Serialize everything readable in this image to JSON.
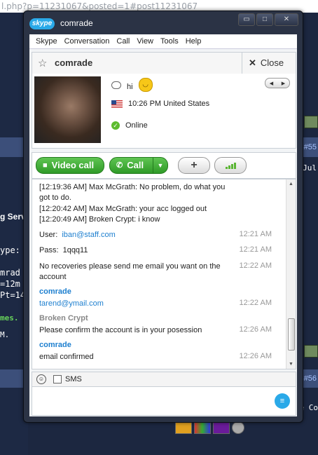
{
  "browser": {
    "url_fragment": "l.php?p=11231067&posted=1#post11231067"
  },
  "background_forum": {
    "post_num_1": "#55",
    "post_num_2": "#56",
    "fragment_jul": "Jul",
    "fragment_serv": "g Serv",
    "fragment_ype": "ype:",
    "fragment_mrad": "mrad",
    "fragment_12m": "=12m",
    "fragment_pt14": "Pt=14",
    "fragment_mes": "mes.",
    "fragment_m": "M.",
    "fragment_eco": "e Co"
  },
  "window": {
    "app_logo": "skype",
    "title": "comrade",
    "menu": [
      "Skype",
      "Conversation",
      "Call",
      "View",
      "Tools",
      "Help"
    ]
  },
  "contact_header": {
    "name": "comrade",
    "close_label": "Close",
    "star_icon": "star-icon",
    "close_icon": "close-icon"
  },
  "profile": {
    "mood": "hi",
    "local_time": "10:26 PM United States",
    "status": "Online"
  },
  "actions": {
    "video_call_label": "Video call",
    "call_label": "Call",
    "add_label": "+"
  },
  "chat": {
    "lines": [
      "[12:19:36 AM] Max McGrath: No problem, do what you",
      "got to do.",
      "[12:20:42 AM] Max McGrath: your acc logged out",
      "[12:20:49 AM] Broken Crypt: i know"
    ],
    "user_label": "User:",
    "user_value": "iban@staff.com",
    "user_time": "12:21 AM",
    "pass_label": "Pass:",
    "pass_value": "1qqq11",
    "pass_time": "12:21 AM",
    "recov_line1": "No recoveries please send me email you want on the",
    "recov_line2": "account",
    "recov_time": "12:22 AM",
    "sender_comrade": "comrade",
    "email": "tarend@ymail.com",
    "email_time": "12:22 AM",
    "sender_broken": "Broken Crypt",
    "confirm_msg": "Please confirm the account is in your posession",
    "confirm_time": "12:26 AM",
    "sender_comrade2": "comrade",
    "email_confirmed": "email confirmed",
    "email_confirmed_time": "12:26 AM"
  },
  "input": {
    "sms_label": "SMS"
  },
  "colors": {
    "accent": "#2aa9e8",
    "green": "#3aa632",
    "link": "#1d7fcf"
  }
}
